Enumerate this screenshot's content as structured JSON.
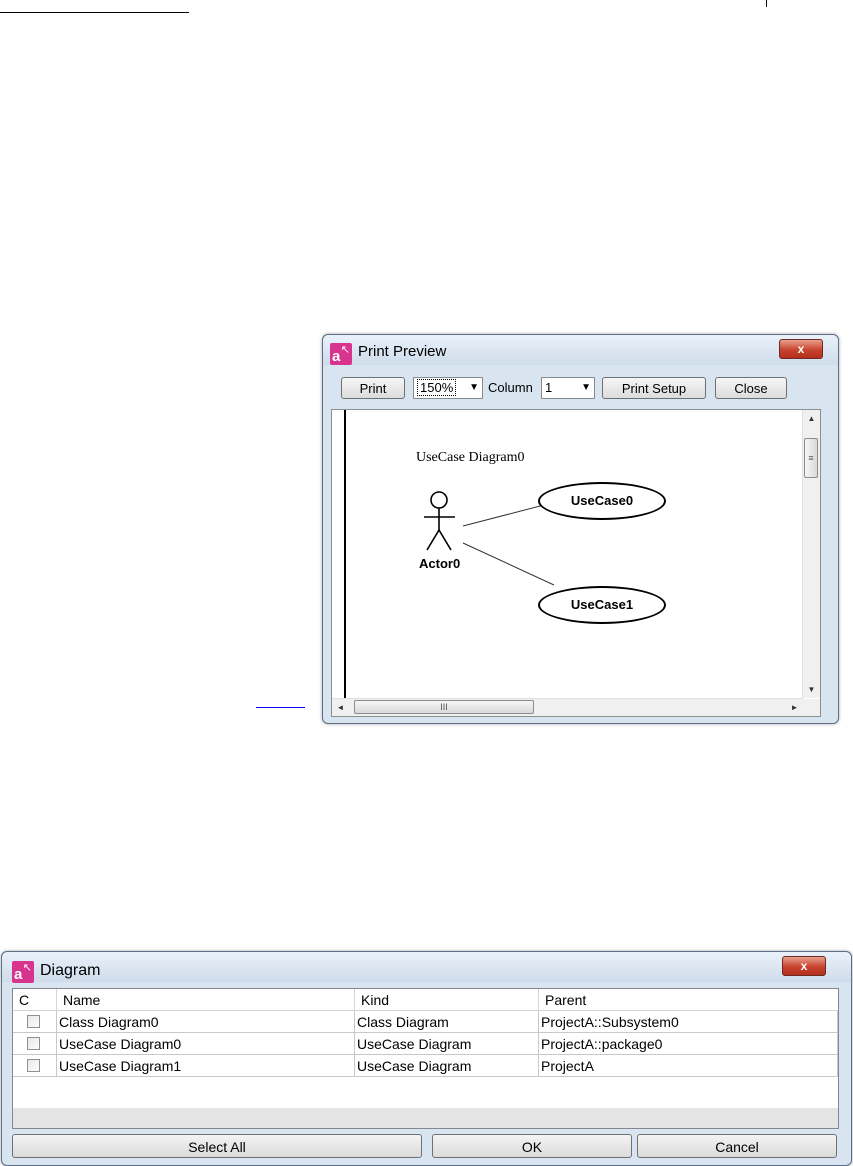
{
  "print_preview": {
    "title": "Print Preview",
    "close_glyph": "x",
    "toolbar": {
      "print_label": "Print",
      "zoom_value": "150%",
      "column_label": "Column",
      "column_value": "1",
      "print_setup_label": "Print Setup",
      "close_label": "Close"
    },
    "canvas": {
      "diagram_title": "UseCase Diagram0",
      "actor_label": "Actor0",
      "usecases": [
        "UseCase0",
        "UseCase1"
      ]
    },
    "scroll_icons": {
      "up": "▲",
      "down": "▼",
      "left": "◄",
      "right": "►",
      "grip_v": "≡",
      "grip_h": "III"
    }
  },
  "diagram_dialog": {
    "title": "Diagram",
    "close_glyph": "x",
    "columns": [
      "C",
      "Name",
      "Kind",
      "Parent"
    ],
    "rows": [
      {
        "checked": false,
        "name": "Class Diagram0",
        "kind": "Class Diagram",
        "parent": "ProjectA::Subsystem0"
      },
      {
        "checked": false,
        "name": "UseCase Diagram0",
        "kind": "UseCase Diagram",
        "parent": "ProjectA::package0"
      },
      {
        "checked": false,
        "name": "UseCase Diagram1",
        "kind": "UseCase Diagram",
        "parent": "ProjectA"
      }
    ],
    "buttons": {
      "select_all": "Select All",
      "ok": "OK",
      "cancel": "Cancel"
    }
  },
  "colors": {
    "app_icon": "#d8348f",
    "close_button": "#c8432f",
    "window_frame": "#d9e4f1"
  }
}
